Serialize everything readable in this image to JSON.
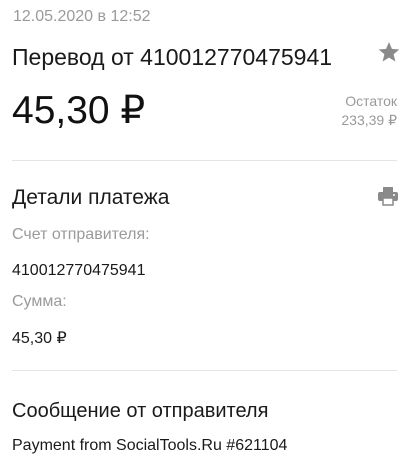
{
  "header": {
    "date": "12.05.2020 в 12:52",
    "title": "Перевод от 410012770475941",
    "amount": "45,30 ₽",
    "balance_label": "Остаток",
    "balance_value": "233,39 ₽"
  },
  "icons": {
    "favorite": "star-icon",
    "print": "printer-icon"
  },
  "details": {
    "title": "Детали платежа",
    "sender_label": "Счет отправителя:",
    "sender_value": "410012770475941",
    "sum_label": "Сумма:",
    "sum_value": "45,30 ₽"
  },
  "message": {
    "title": "Сообщение от отправителя",
    "text": "Payment from SocialTools.Ru #621104"
  },
  "colors": {
    "muted": "#9a9a9a",
    "icon": "#8a8a8a",
    "divider": "#e4e4e4"
  }
}
